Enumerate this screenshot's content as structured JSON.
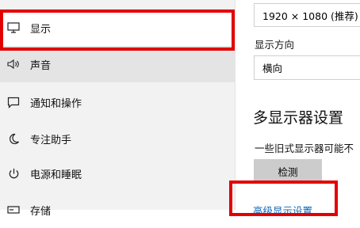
{
  "sidebar": {
    "items": [
      {
        "label": "显示",
        "icon": "monitor-icon",
        "selected": true
      },
      {
        "label": "声音",
        "icon": "speaker-icon"
      },
      {
        "label": "通知和操作",
        "icon": "notification-icon"
      },
      {
        "label": "专注助手",
        "icon": "moon-icon"
      },
      {
        "label": "电源和睡眠",
        "icon": "power-icon"
      },
      {
        "label": "存储",
        "icon": "storage-icon"
      }
    ]
  },
  "main": {
    "resolution_value": "1920 × 1080 (推荐)",
    "orientation_label": "显示方向",
    "orientation_value": "横向",
    "multi_display_heading": "多显示器设置",
    "legacy_note": "一些旧式显示器可能不",
    "detect_button": "检测",
    "advanced_link": "高级显示设置"
  },
  "colors": {
    "highlight": "#e30000",
    "link": "#0a66b8"
  }
}
